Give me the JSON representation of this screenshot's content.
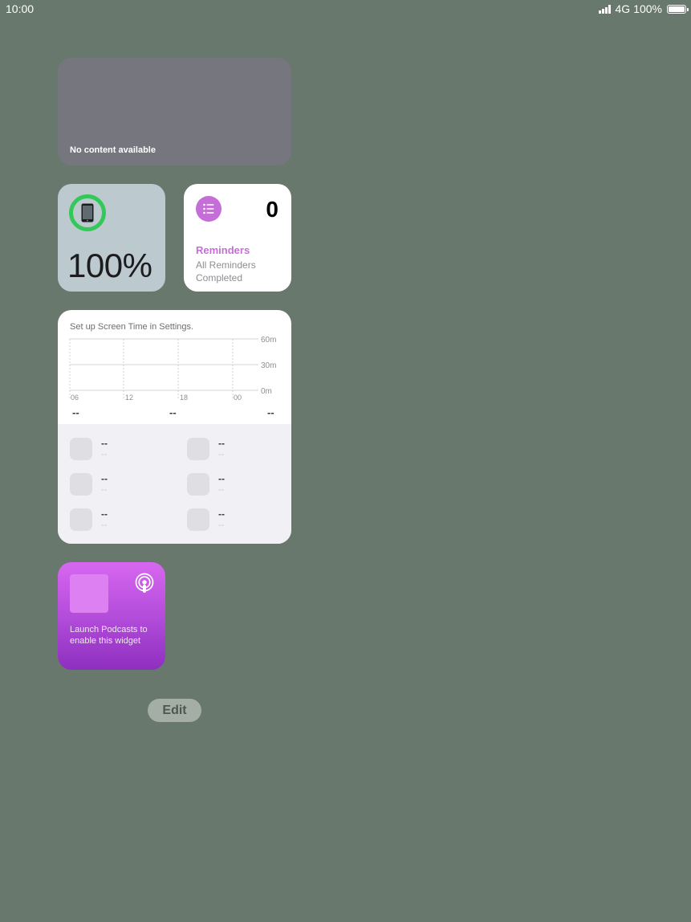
{
  "status_bar": {
    "time": "10:00",
    "network": "4G",
    "battery_text": "100%",
    "battery_level": 1.0
  },
  "widgets": {
    "no_content": {
      "message": "No content available"
    },
    "battery": {
      "percent_text": "100%",
      "level": 1.0,
      "ring_color": "#34c759",
      "device_icon": "ipad-icon"
    },
    "reminders": {
      "count": "0",
      "title": "Reminders",
      "subtitle": "All Reminders Completed",
      "accent_color": "#c56ed8",
      "icon": "list-icon"
    },
    "screen_time": {
      "setup_message": "Set up Screen Time in Settings.",
      "y_labels": [
        "60m",
        "30m",
        "0m"
      ],
      "x_labels": [
        "06",
        "12",
        "18",
        "00"
      ],
      "totals": [
        "--",
        "--",
        "--"
      ],
      "apps": [
        {
          "name": "--",
          "time": "--"
        },
        {
          "name": "--",
          "time": "--"
        },
        {
          "name": "--",
          "time": "--"
        },
        {
          "name": "--",
          "time": "--"
        },
        {
          "name": "--",
          "time": "--"
        },
        {
          "name": "--",
          "time": "--"
        }
      ]
    },
    "podcasts": {
      "message": "Launch Podcasts to enable this widget",
      "icon": "podcasts-icon"
    }
  },
  "edit_button": {
    "label": "Edit"
  }
}
